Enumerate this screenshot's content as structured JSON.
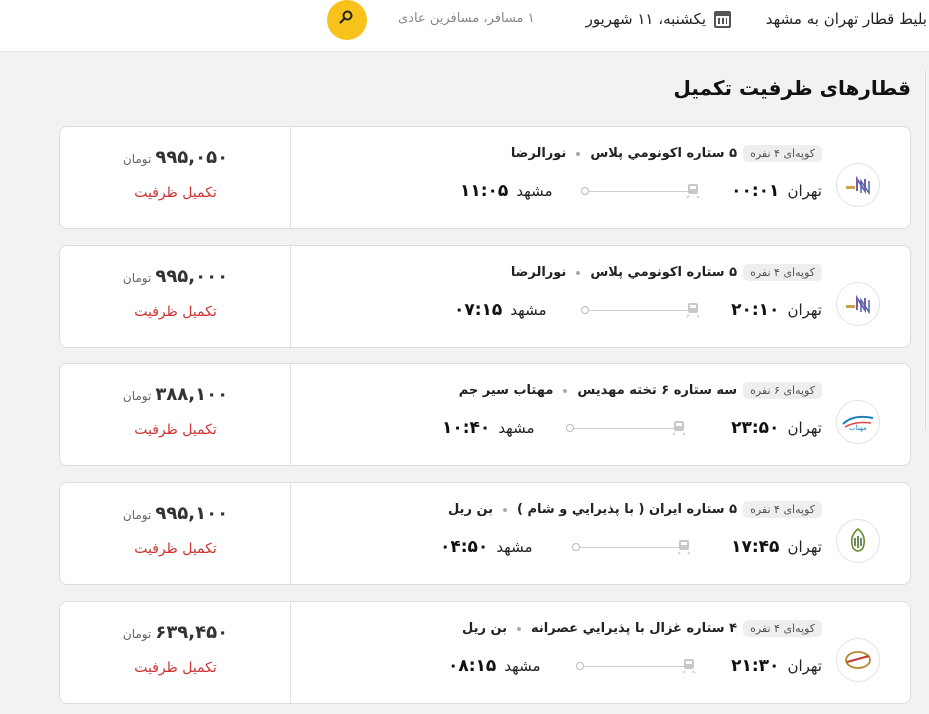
{
  "header": {
    "route": "بلیط قطار تهران به مشهد",
    "date": "یکشنبه، ۱۱ شهریور",
    "passengers": "۱ مسافر، مسافرین عادی",
    "calendar_icon": "calendar-icon",
    "search_icon": "search-icon",
    "accent": "#f7c21a"
  },
  "section": {
    "title": "قطارهای ظرفیت تکمیل"
  },
  "trains": [
    {
      "coupe": "کوپه‌ای ۴ نفره",
      "name": "۵ ستاره اکونومي پلاس",
      "company": "نورالرضا",
      "from": "تهران",
      "dep": "۰۰:۰۱",
      "to": "مشهد",
      "arr": "۱۱:۰۵",
      "price": "۹۹۵,۰۵۰",
      "unit": "تومان",
      "status": "تکمیل ظرفیت",
      "logo": "nooralreza-logo"
    },
    {
      "coupe": "کوپه‌ای ۴ نفره",
      "name": "۵ ستاره اکونومي پلاس",
      "company": "نورالرضا",
      "from": "تهران",
      "dep": "۲۰:۱۰",
      "to": "مشهد",
      "arr": "۰۷:۱۵",
      "price": "۹۹۵,۰۰۰",
      "unit": "تومان",
      "status": "تکمیل ظرفیت",
      "logo": "nooralreza-logo"
    },
    {
      "coupe": "کوپه‌ای ۶ نفره",
      "name": "سه ستاره ۶ تخته مهدیس",
      "company": "مهتاب سیر جم",
      "from": "تهران",
      "dep": "۲۳:۵۰",
      "to": "مشهد",
      "arr": "۱۰:۴۰",
      "price": "۳۸۸,۱۰۰",
      "unit": "تومان",
      "status": "تکمیل ظرفیت",
      "logo": "mahtab-logo"
    },
    {
      "coupe": "کوپه‌ای ۴ نفره",
      "name": "۵ ستاره ایران ( با پذيرايي و شام )",
      "company": "بن ریل",
      "from": "تهران",
      "dep": "۱۷:۴۵",
      "to": "مشهد",
      "arr": "۰۴:۵۰",
      "price": "۹۹۵,۱۰۰",
      "unit": "تومان",
      "status": "تکمیل ظرفیت",
      "logo": "bonrail-logo"
    },
    {
      "coupe": "کوپه‌ای ۴ نفره",
      "name": "۴ ستاره غزال با پذيرايي عصرانه",
      "company": "بن ریل",
      "from": "تهران",
      "dep": "۲۱:۳۰",
      "to": "مشهد",
      "arr": "۰۸:۱۵",
      "price": "۶۳۹,۴۵۰",
      "unit": "تومان",
      "status": "تکمیل ظرفیت",
      "logo": "ghazal-logo"
    }
  ],
  "colors": {
    "status": "#cc3333",
    "price": "#333333"
  }
}
